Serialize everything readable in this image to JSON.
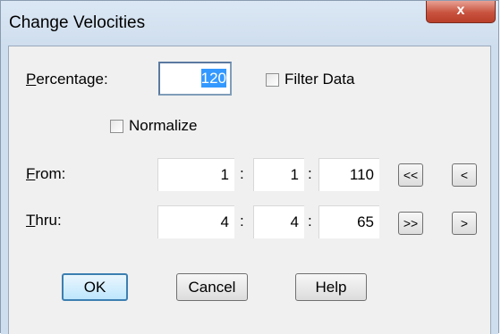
{
  "window": {
    "title": "Change Velocities",
    "close_label": "x"
  },
  "percentage": {
    "label_underline": "P",
    "label_rest": "ercentage:",
    "value": "120"
  },
  "filter_data": {
    "label": "Filter Data",
    "checked": false
  },
  "normalize": {
    "label": "Normalize",
    "checked": false
  },
  "from": {
    "label_underline": "F",
    "label_rest": "rom:",
    "values": [
      "1",
      "1",
      "110"
    ],
    "separator": ":",
    "first_label": "<<",
    "prev_label": "<"
  },
  "thru": {
    "label_underline": "T",
    "label_rest": "hru:",
    "values": [
      "4",
      "4",
      "65"
    ],
    "separator": ":",
    "last_label": ">>",
    "next_label": ">"
  },
  "buttons": {
    "ok": "OK",
    "cancel": "Cancel",
    "help": "Help"
  }
}
